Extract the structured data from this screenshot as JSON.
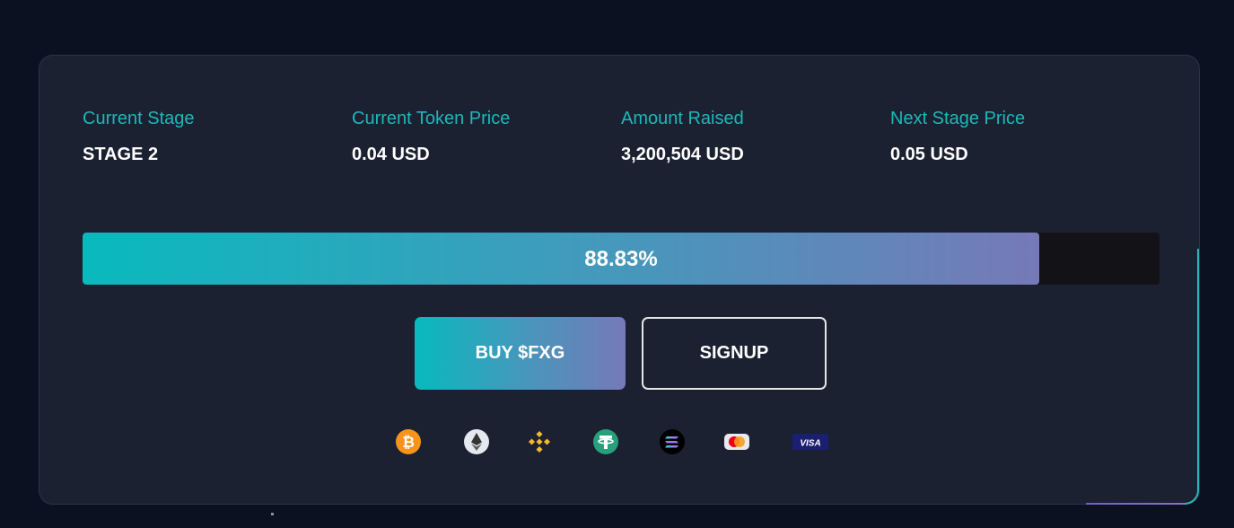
{
  "stats": [
    {
      "label": "Current Stage",
      "value": "STAGE 2"
    },
    {
      "label": "Current Token Price",
      "value": "0.04 USD"
    },
    {
      "label": "Amount Raised",
      "value": "3,200,504 USD"
    },
    {
      "label": "Next Stage Price",
      "value": "0.05 USD"
    }
  ],
  "progress": {
    "label": "88.83%",
    "percent": 88.83
  },
  "buttons": {
    "buy_label": "BUY $FXG",
    "signup_label": "SIGNUP"
  },
  "payment_methods": [
    {
      "icon": "bitcoin-icon",
      "color": "#f7931a"
    },
    {
      "icon": "ethereum-icon",
      "color": "#e6e8f0"
    },
    {
      "icon": "binance-icon",
      "color": "#f3ba2f"
    },
    {
      "icon": "tether-icon",
      "color": "#26a17b"
    },
    {
      "icon": "solana-icon",
      "color": "#000000"
    },
    {
      "icon": "mastercard-icon",
      "color": "#eb001b"
    },
    {
      "icon": "visa-icon",
      "color": "#1a1f71",
      "text": "VISA"
    }
  ],
  "colors": {
    "accent": "#1db8ba",
    "gradient_start": "#08babd",
    "gradient_end": "#7679b9",
    "panel_bg": "#1b2130",
    "page_bg": "#0b1120"
  }
}
